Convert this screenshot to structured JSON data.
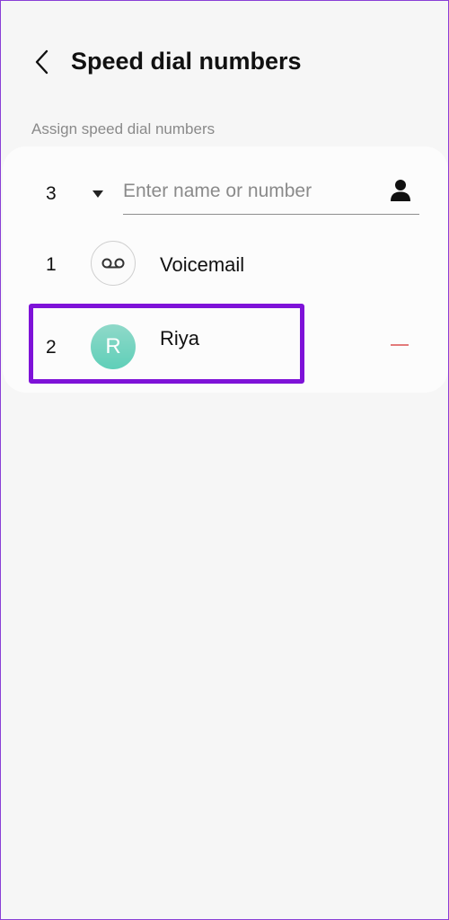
{
  "header": {
    "title": "Speed dial numbers",
    "back_icon": "chevron-left-icon"
  },
  "section": {
    "label": "Assign speed dial numbers"
  },
  "new_entry": {
    "number": "3",
    "dropdown_icon": "triangle-down-icon",
    "placeholder": "Enter name or number",
    "value": "",
    "contact_icon": "person-icon"
  },
  "entries": [
    {
      "number": "1",
      "name": "Voicemail",
      "icon": "voicemail-icon"
    },
    {
      "number": "2",
      "name": "Riya",
      "avatar_initial": "R",
      "avatar_color": "#6dd3be",
      "remove_icon": "minus-icon",
      "remove_color": "#e37a7a"
    }
  ],
  "colors": {
    "highlight": "#7e12d8",
    "background": "#f6f6f6"
  }
}
